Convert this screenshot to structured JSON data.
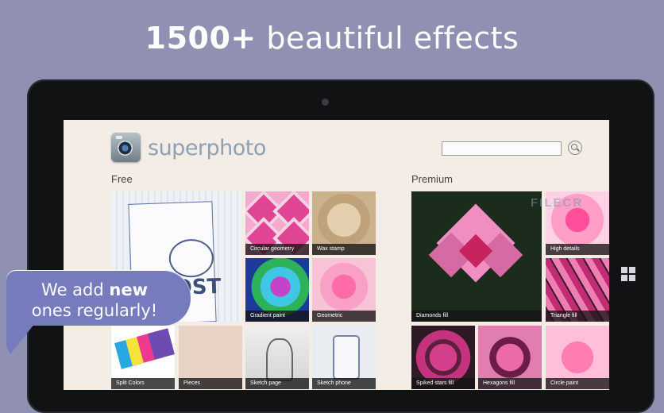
{
  "headline": {
    "number": "1500+",
    "rest": " beautiful effects"
  },
  "app": {
    "name": "superphoto",
    "search_placeholder": ""
  },
  "sections": {
    "free_label": "Free",
    "premium_label": "Premium"
  },
  "free_effects": [
    "Circular geometry",
    "Wax stamp",
    "Gradient paint",
    "Geometric",
    "Split Colors",
    "Pieces",
    "Sketch page",
    "Sketch phone"
  ],
  "free_big_text": "LOST",
  "premium_effects": [
    "Diamonds fill",
    "High details",
    "Triangle fill",
    "Spiked stars fill",
    "Hexagons fill",
    "Circle paint"
  ],
  "watermark": "FILECR",
  "callout": {
    "line1_pre": "We add ",
    "line1_bold": "new",
    "line2": "ones regularly!"
  },
  "colors": {
    "background": "#8f90b2",
    "callout": "#757bbd",
    "screen": "#f4ede6"
  }
}
